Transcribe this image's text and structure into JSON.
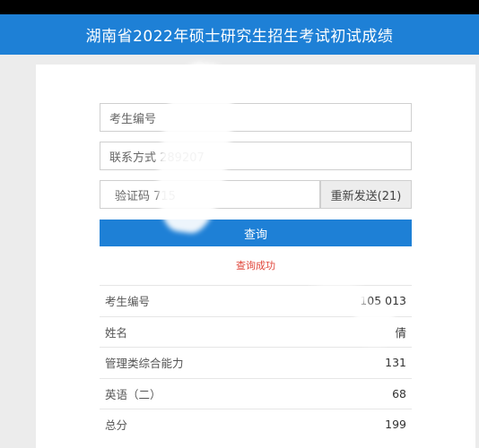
{
  "header": {
    "title": "湖南省2022年硕士研究生招生考试初试成绩"
  },
  "form": {
    "exam_id_value": "考生编号",
    "phone_value": "联系方式 289207",
    "code_value": "验证码 715",
    "resend_label": "重新发送(21)",
    "query_label": "查询"
  },
  "status": {
    "message": "查询成功"
  },
  "results": [
    {
      "label": "考生编号",
      "value": "105 013"
    },
    {
      "label": "姓名",
      "value": "倩"
    },
    {
      "label": "管理类综合能力",
      "value": "131"
    },
    {
      "label": "英语（二）",
      "value": "68"
    },
    {
      "label": "总分",
      "value": "199"
    }
  ]
}
